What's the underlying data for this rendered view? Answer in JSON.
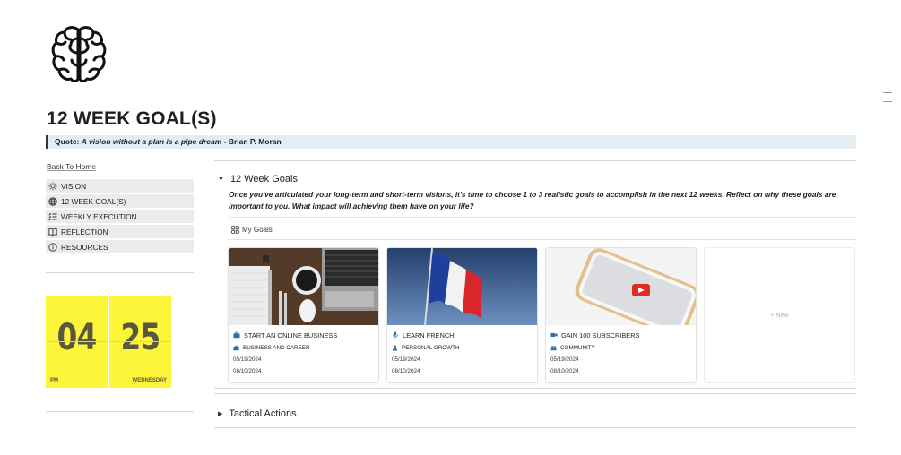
{
  "page": {
    "icon": "brain-icon",
    "title": "12 WEEK GOAL(S)",
    "quote_label": "Quote:",
    "quote_text": "A vision without a plan is a pipe dream",
    "quote_author": " - Brian P. Moran"
  },
  "sidebar": {
    "back_link": "Back To Home",
    "items": [
      {
        "label": "VISION",
        "icon": "sun-icon"
      },
      {
        "label": "12 WEEK GOAL(S)",
        "icon": "globe-icon"
      },
      {
        "label": "WEEKLY EXECUTION",
        "icon": "checklist-icon"
      },
      {
        "label": "REFLECTION",
        "icon": "book-icon"
      },
      {
        "label": "RESOURCES",
        "icon": "info-icon"
      }
    ]
  },
  "clock": {
    "hour": "04",
    "minute": "25",
    "period": "PM",
    "weekday": "WEDNESDAY",
    "color": "#fcf53a"
  },
  "goals_section": {
    "heading": "12 Week Goals",
    "intro": "Once you've articulated your long-term and short-term visions, it's time to choose 1 to 3 realistic goals to accomplish in the next 12 weeks. Reflect on why these goals are important to you. What impact will achieving them have on your life?",
    "view_label": "My Goals",
    "view_icon": "gallery-icon",
    "new_label": "+ New",
    "cards": [
      {
        "title": "START AN ONLINE BUSINESS",
        "title_icon": "briefcase-icon",
        "tag": "BUSINESS AND CAREER",
        "tag_icon": "briefcase-icon",
        "start": "05/19/2024",
        "end": "08/10/2024"
      },
      {
        "title": "LEARN FRENCH",
        "title_icon": "microphone-icon",
        "tag": "PERSONAL GROWTH",
        "tag_icon": "person-icon",
        "start": "05/19/2024",
        "end": "08/10/2024"
      },
      {
        "title": "GAIN 100 SUBSCRIBERS",
        "title_icon": "video-camera-icon",
        "tag": "COMMUNITY",
        "tag_icon": "people-icon",
        "start": "05/19/2024",
        "end": "08/10/2024"
      }
    ]
  },
  "tactical_section": {
    "heading": "Tactical Actions"
  }
}
